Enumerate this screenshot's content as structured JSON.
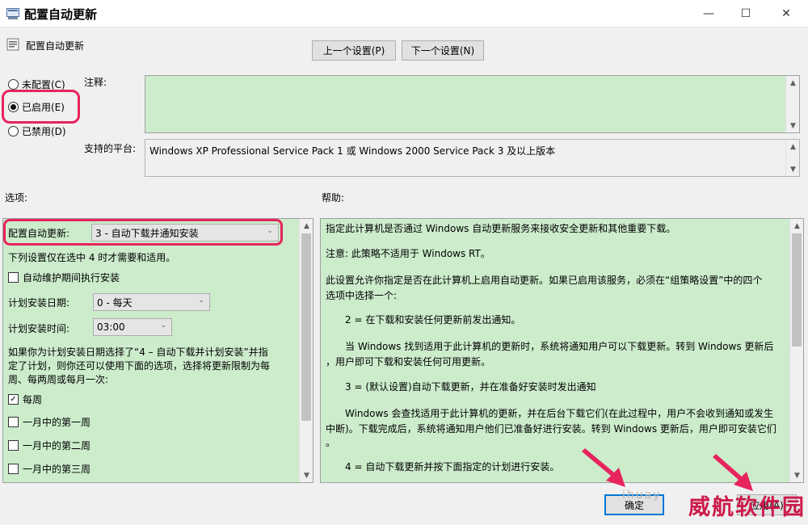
{
  "window": {
    "title": "配置自动更新",
    "minimize": "—",
    "maximize": "☐",
    "close": "✕"
  },
  "header": {
    "policy_name": "配置自动更新",
    "prev_button": "上一个设置(P)",
    "next_button": "下一个设置(N)"
  },
  "state": {
    "not_configured": "未配置(C)",
    "enabled": "已启用(E)",
    "disabled": "已禁用(D)",
    "selected": "enabled"
  },
  "comment": {
    "label": "注释:",
    "value": ""
  },
  "platform": {
    "label": "支持的平台:",
    "value": "Windows XP Professional Service Pack 1 或 Windows 2000 Service Pack 3 及以上版本"
  },
  "options": {
    "label": "选项:",
    "configure_label": "配置自动更新:",
    "configure_value": "3 - 自动下载并通知安装",
    "note": "下列设置仅在选中 4 时才需要和适用。",
    "maintenance_label": "自动维护期间执行安装",
    "maintenance_checked": false,
    "day_label": "计划安装日期:",
    "day_value": "0 - 每天",
    "time_label": "计划安装时间:",
    "time_value": "03:00",
    "schedule_note_1": "如果你为计划安装日期选择了“4 – 自动下载并计划安装”并指",
    "schedule_note_2": "定了计划，则你还可以使用下面的选项，选择将更新限制为每",
    "schedule_note_3": "周、每两周或每月一次:",
    "weekly_label": "每周",
    "weekly_checked": true,
    "first_week_label": "一月中的第一周",
    "second_week_label": "一月中的第二周",
    "third_week_label": "一月中的第三周"
  },
  "help": {
    "label": "帮助:",
    "p1": "指定此计算机是否通过 Windows 自动更新服务来接收安全更新和其他重要下载。",
    "p2": "注意: 此策略不适用于 Windows RT。",
    "p3a": "此设置允许你指定是否在此计算机上启用自动更新。如果已启用该服务，必须在“组策略设置”中的四个",
    "p3b": "选项中选择一个:",
    "p4": "2 = 在下载和安装任何更新前发出通知。",
    "p5a": "当 Windows 找到适用于此计算机的更新时，系统将通知用户可以下载更新。转到 Windows 更新后",
    "p5b": "，用户即可下载和安装任何可用更新。",
    "p6": "3 = (默认设置)自动下载更新，并在准备好安装时发出通知",
    "p7a": "Windows 会查找适用于此计算机的更新，并在后台下载它们(在此过程中，用户不会收到通知或发生",
    "p7b": "中断)。下载完成后，系统将通知用户他们已准备好进行安装。转到 Windows 更新后，用户即可安装它们",
    "p7c": "。",
    "p8": "4 = 自动下载更新并按下面指定的计划进行安装。"
  },
  "footer": {
    "ok_button": "确定",
    "apply_button": "应用(A)"
  },
  "watermark": {
    "text": "威航软件园",
    "faint": "ihuay"
  },
  "colors": {
    "accent_annotation": "#e8245e",
    "green_panel": "#cceccc",
    "watermark": "#cc1a4a"
  }
}
